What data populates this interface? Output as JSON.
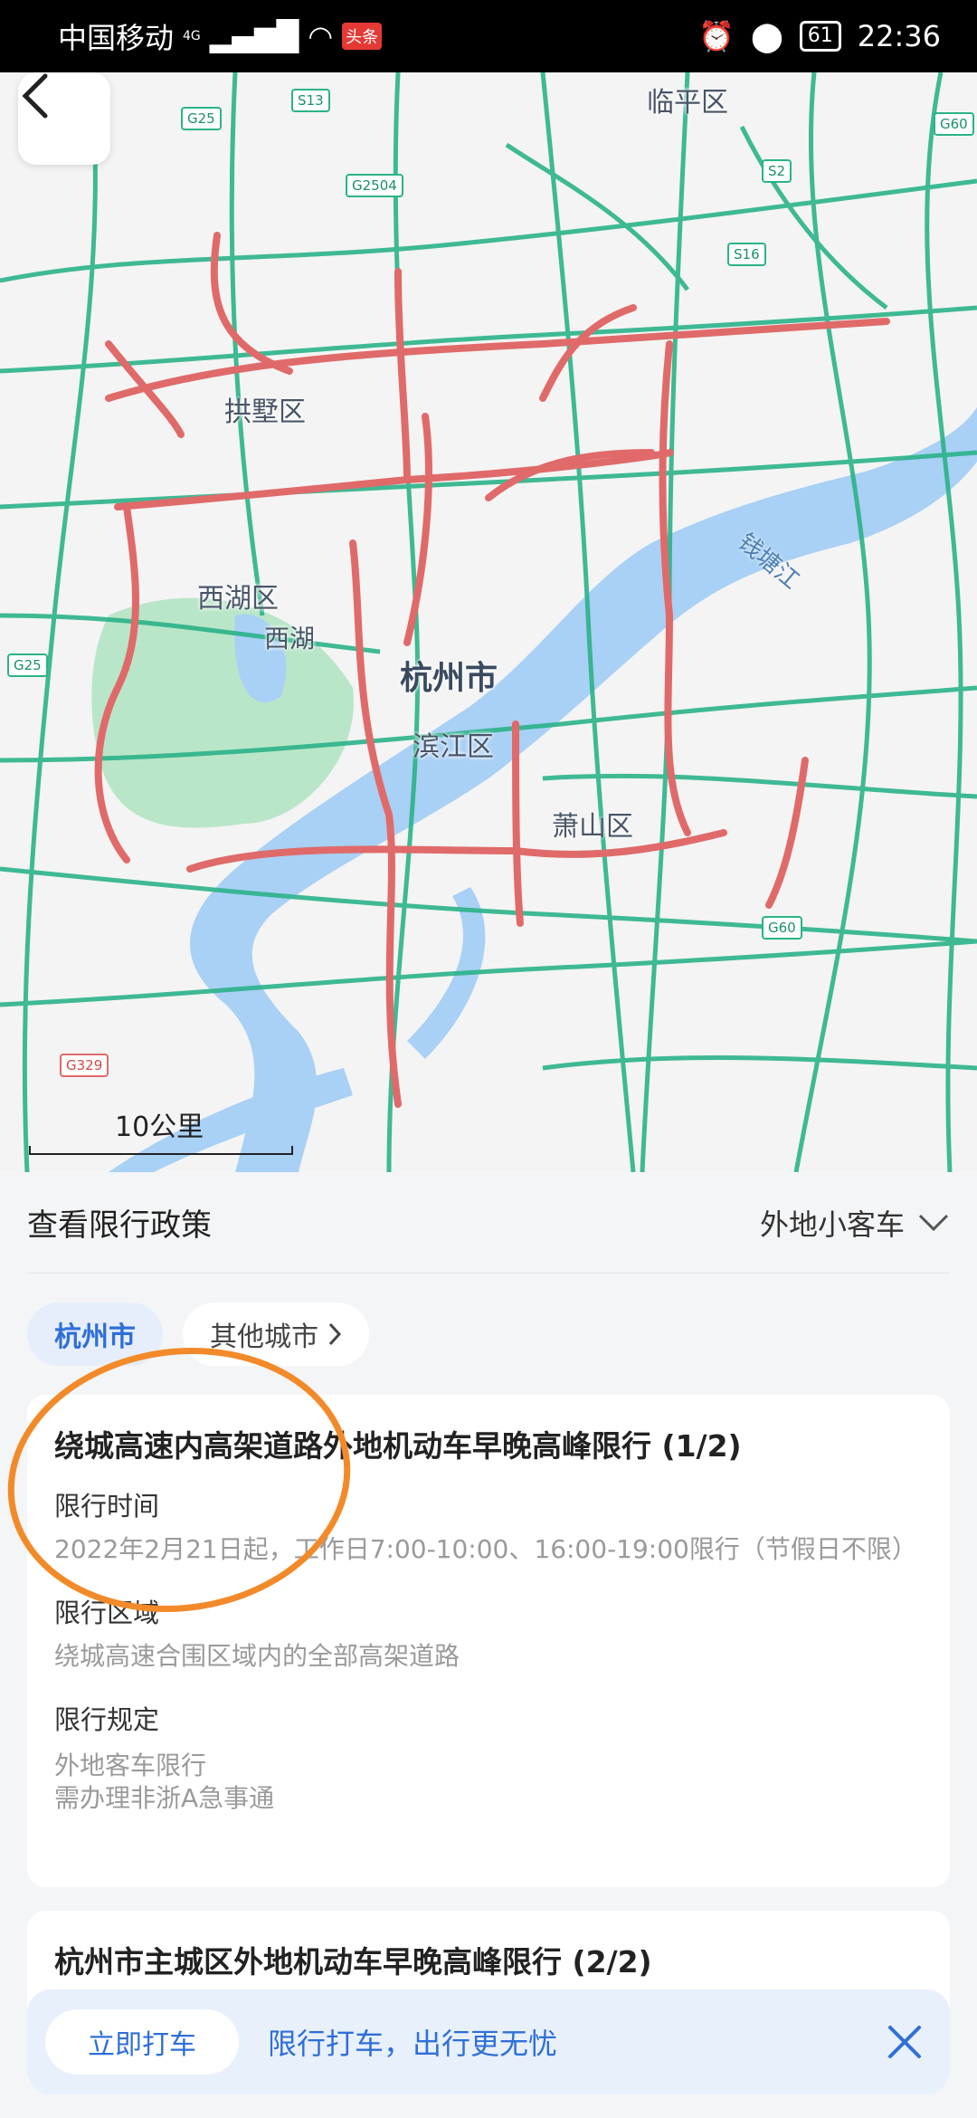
{
  "status_bar": {
    "carrier": "中国移动",
    "network": "4G",
    "app_badge": "头条",
    "battery": "61",
    "time": "22:36"
  },
  "map": {
    "district_labels": [
      "临平区",
      "拱墅区",
      "西湖区",
      "西湖",
      "滨江区",
      "萧山区"
    ],
    "city_label": "杭州市",
    "river_label": "钱塘江",
    "road_signs": [
      "G25",
      "S13",
      "G2504",
      "S2",
      "S16",
      "G60",
      "G25",
      "G60",
      "G329"
    ],
    "scale_label": "10公里",
    "colors": {
      "road_green": "#2bb389",
      "congestion_red": "#e06a6a",
      "water": "#a9d0f5",
      "park": "#b9e6c9"
    }
  },
  "panel": {
    "title": "查看限行政策",
    "vehicle_type": "外地小客车",
    "tabs": {
      "active": "杭州市",
      "other": "其他城市"
    },
    "cards": [
      {
        "title": "绕城高速内高架道路外地机动车早晚高峰限行 (1/2)",
        "time_label": "限行时间",
        "time_value": "2022年2月21日起，工作日7:00-10:00、16:00-19:00限行（节假日不限）",
        "area_label": "限行区域",
        "area_value": "绕城高速合围区域内的全部高架道路",
        "rule_label": "限行规定",
        "rule_value_1": "外地客车限行",
        "rule_value_2": "需办理非浙A急事通"
      },
      {
        "title": "杭州市主城区外地机动车早晚高峰限行 (2/2)"
      }
    ]
  },
  "banner": {
    "button_label": "立即打车",
    "text": "限行打车，出行更无忧"
  }
}
